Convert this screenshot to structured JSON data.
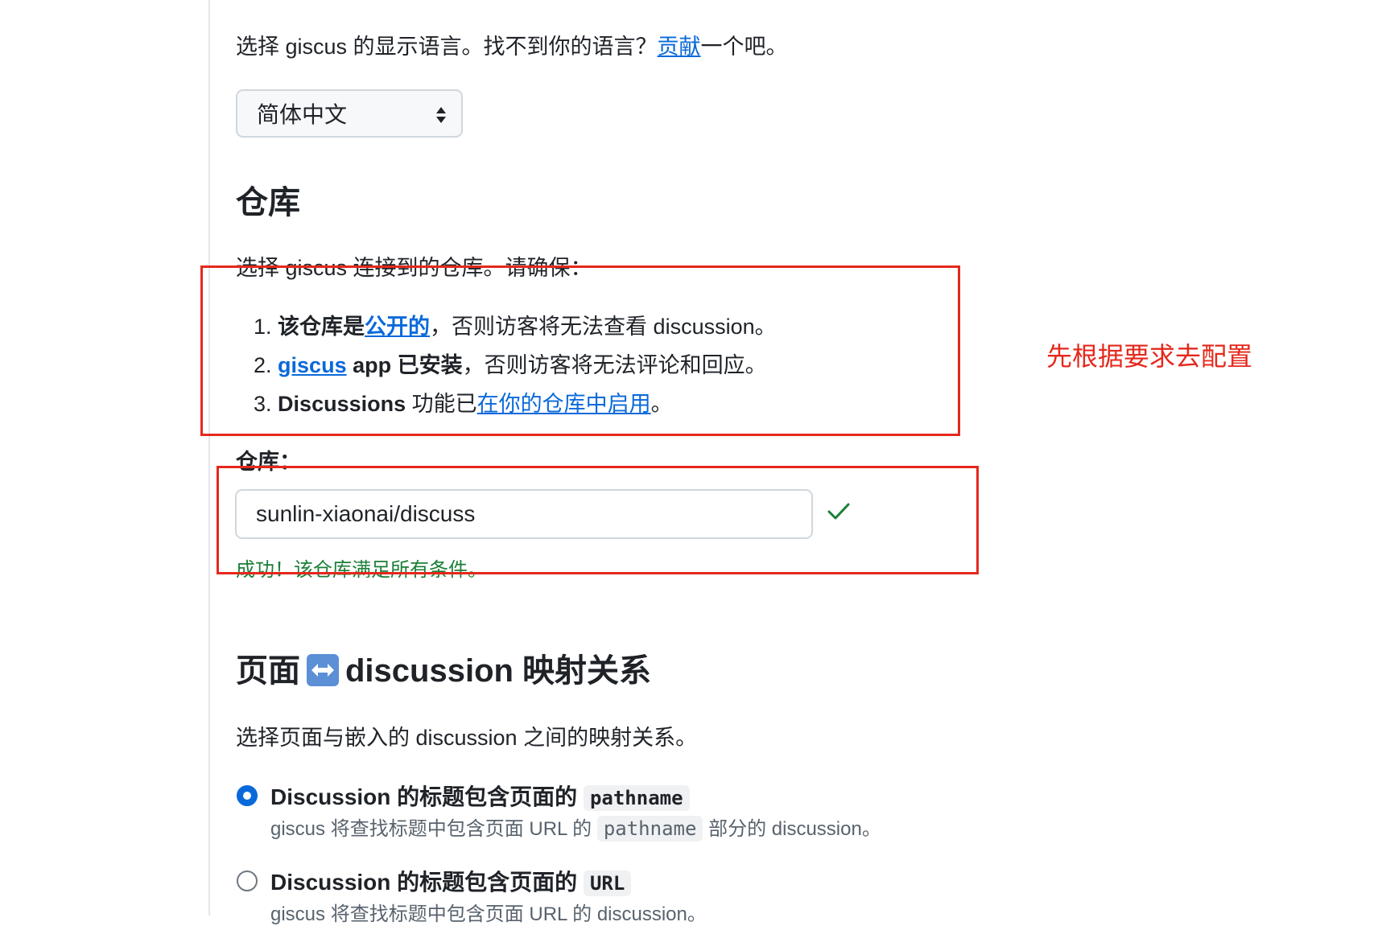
{
  "language": {
    "intro_before": "选择 giscus 的显示语言。找不到你的语言？",
    "contribute_link": "贡献",
    "intro_after": "一个吧。",
    "selected": "简体中文"
  },
  "repo": {
    "heading": "仓库",
    "intro": "选择 giscus 连接到的仓库。请确保：",
    "items": [
      {
        "num": "1.",
        "bold": "该仓库是",
        "link": "公开的",
        "rest": "，否则访客将无法查看 discussion。"
      },
      {
        "num": "2.",
        "link": "giscus",
        "bold": " app 已安装",
        "rest": "，否则访客将无法评论和回应。"
      },
      {
        "num": "3.",
        "bold": "Discussions",
        "rest_before": " 功能已",
        "link": "在你的仓库中启用",
        "rest": "。"
      }
    ],
    "field_label": "仓库：",
    "field_value": "sunlin-xiaonai/discuss",
    "success_text": "成功！该仓库满足所有条件。"
  },
  "mapping": {
    "heading_before": "页面",
    "heading_after": "discussion 映射关系",
    "emoji_icon": "left-right-arrow-icon",
    "intro": "选择页面与嵌入的 discussion 之间的映射关系。",
    "options": [
      {
        "title": "Discussion 的标题包含页面的",
        "code": "pathname",
        "desc_before": "giscus 将查找标题中包含页面 URL 的",
        "desc_code": "pathname",
        "desc_after": "部分的 discussion。",
        "selected": true
      },
      {
        "title": "Discussion 的标题包含页面的",
        "code": "URL",
        "desc_before": "giscus 将查找标题中包含页面 URL 的 discussion。",
        "selected": false
      }
    ]
  },
  "annotation": {
    "text": "先根据要求去配置",
    "color": "#e5281c"
  },
  "colors": {
    "link": "#0969da",
    "success": "#1a7f37",
    "radio_selected": "#0969da"
  }
}
